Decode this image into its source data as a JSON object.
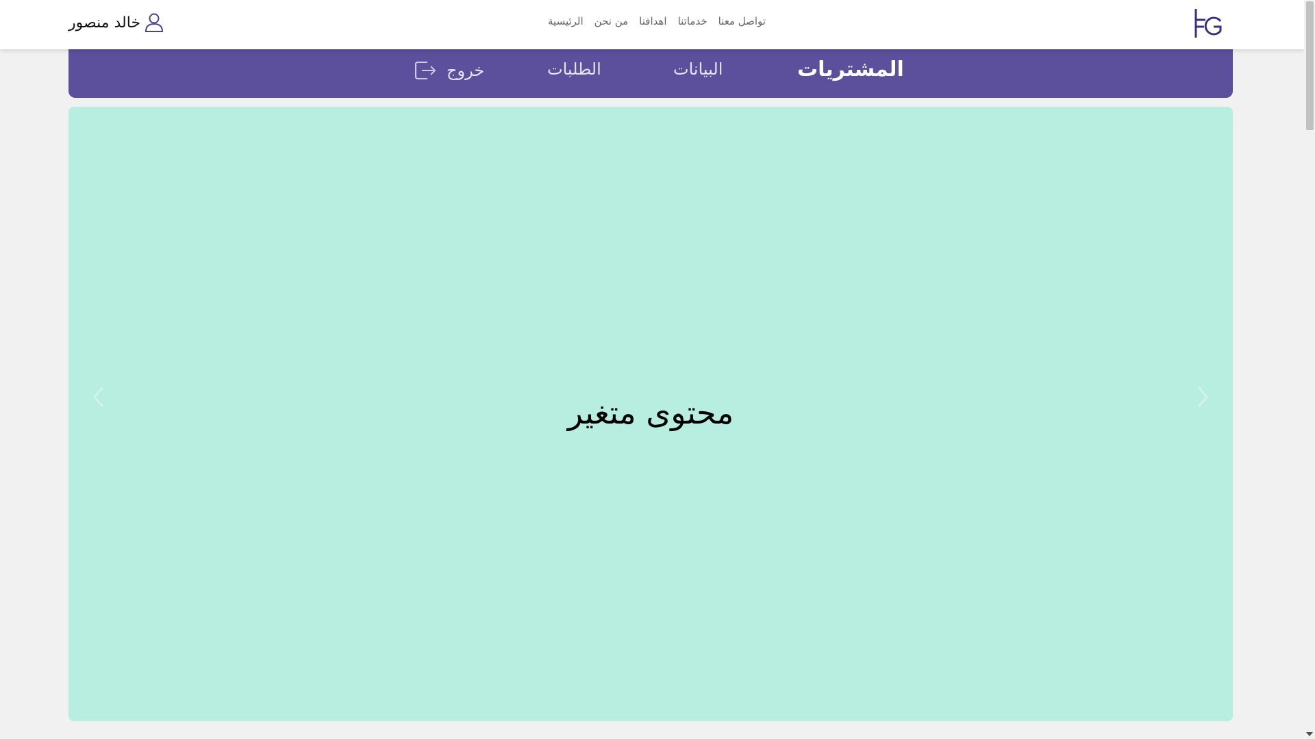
{
  "brand": {
    "logo_text": "FG",
    "color": "#3b2e85"
  },
  "top_nav": [
    {
      "label": "الرئيسية"
    },
    {
      "label": "من نحن"
    },
    {
      "label": "اهدافنا"
    },
    {
      "label": "خدماتنا"
    },
    {
      "label": "تواصل معنا"
    }
  ],
  "user": {
    "name": "خالد منصور",
    "icon": "user-icon"
  },
  "tabs": [
    {
      "label": "المشتريات",
      "active": true
    },
    {
      "label": "البيانات",
      "active": false
    },
    {
      "label": "الطلبات",
      "active": false
    }
  ],
  "logout": {
    "label": "خروج",
    "icon": "logout-icon"
  },
  "panel": {
    "text": "محتوى متغير",
    "background": "#b8eee0"
  },
  "colors": {
    "tabbar": "#5c4f9b",
    "page_background": "#f1f1f1"
  }
}
